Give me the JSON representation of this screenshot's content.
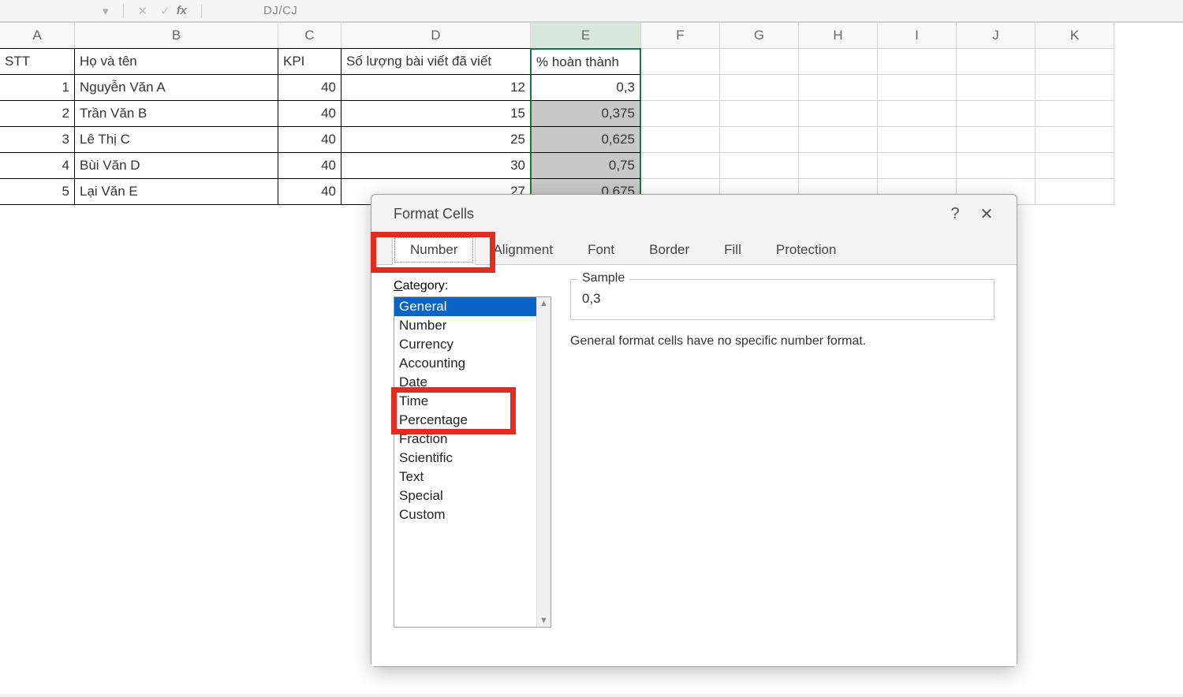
{
  "formula_bar": {
    "fx_label": "fx",
    "crumb": "DJ/CJ"
  },
  "columns": [
    "A",
    "B",
    "C",
    "D",
    "E",
    "F",
    "G",
    "H",
    "I",
    "J",
    "K"
  ],
  "headers": {
    "A": "STT",
    "B": "Họ và tên",
    "C": "KPI",
    "D": "Số lượng bài viết đã viết",
    "E": "% hoàn thành"
  },
  "rows": [
    {
      "stt": "1",
      "name": "Nguyễn Văn A",
      "kpi": "40",
      "count": "12",
      "pct": "0,3"
    },
    {
      "stt": "2",
      "name": "Trần Văn B",
      "kpi": "40",
      "count": "15",
      "pct": "0,375"
    },
    {
      "stt": "3",
      "name": "Lê Thị C",
      "kpi": "40",
      "count": "25",
      "pct": "0,625"
    },
    {
      "stt": "4",
      "name": "Bùi Văn D",
      "kpi": "40",
      "count": "30",
      "pct": "0,75"
    },
    {
      "stt": "5",
      "name": "Lại Văn E",
      "kpi": "40",
      "count": "27",
      "pct": "0,675"
    }
  ],
  "dialog": {
    "title": "Format Cells",
    "help": "?",
    "close": "✕",
    "tabs": [
      "Number",
      "Alignment",
      "Font",
      "Border",
      "Fill",
      "Protection"
    ],
    "active_tab": "Number",
    "category_label": "Category:",
    "category_prefix": "C",
    "categories": [
      "General",
      "Number",
      "Currency",
      "Accounting",
      "Date",
      "Time",
      "Percentage",
      "Fraction",
      "Scientific",
      "Text",
      "Special",
      "Custom"
    ],
    "selected_category": "General",
    "sample_label": "Sample",
    "sample_value": "0,3",
    "description": "General format cells have no specific number format."
  }
}
